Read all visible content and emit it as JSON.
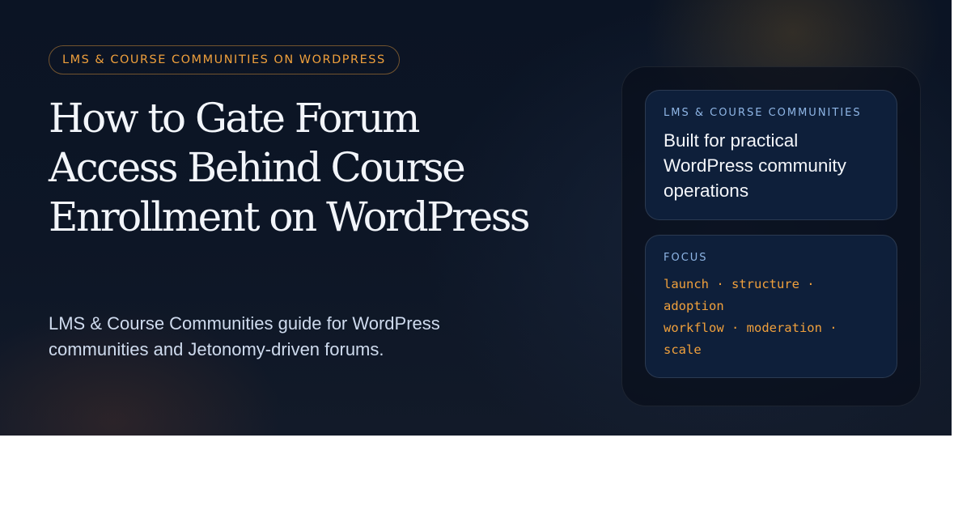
{
  "hero": {
    "eyebrow": "LMS & COURSE COMMUNITIES ON WORDPRESS",
    "title": "How to Gate Forum Access Behind Course Enrollment on WordPress",
    "subtitle": "LMS & Course Communities guide for WordPress communities and Jetonomy-driven forums."
  },
  "panel": {
    "card_category": {
      "label": "LMS & COURSE COMMUNITIES",
      "heading": "Built for practical WordPress community operations"
    },
    "card_focus": {
      "label": "FOCUS",
      "lines": [
        "launch · structure ·",
        "adoption",
        "workflow · moderation ·",
        "scale"
      ]
    }
  },
  "colors": {
    "accent": "#f0a03c",
    "label_blue": "#8fb6e6",
    "background": "#0d1626",
    "card": "#0e1f3a"
  }
}
